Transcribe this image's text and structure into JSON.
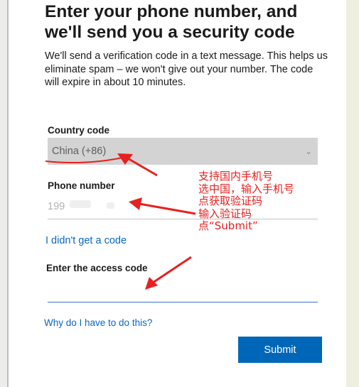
{
  "page": {
    "title": "Enter your phone number, and we'll send you a security code",
    "description": "We'll send a verification code in a text message. This helps us eliminate spam – we won't give out your number. The code will expire in about 10 minutes."
  },
  "form": {
    "country_label": "Country code",
    "country_value": "China (+86)",
    "phone_label": "Phone number",
    "phone_value": "199",
    "resend_link": "I didn't get a code",
    "access_label": "Enter the access code",
    "access_value": "",
    "help_link": "Why do I have to do this?",
    "submit_label": "Submit"
  },
  "annotation": {
    "text": "支持国内手机号\n选中国，输入手机号\n点获取验证码\n输入验证码\n点“Submit”",
    "color": "#e8201f"
  },
  "colors": {
    "link": "#0a67c4",
    "button": "#0067b8",
    "select_bg": "#d3d3d3"
  }
}
